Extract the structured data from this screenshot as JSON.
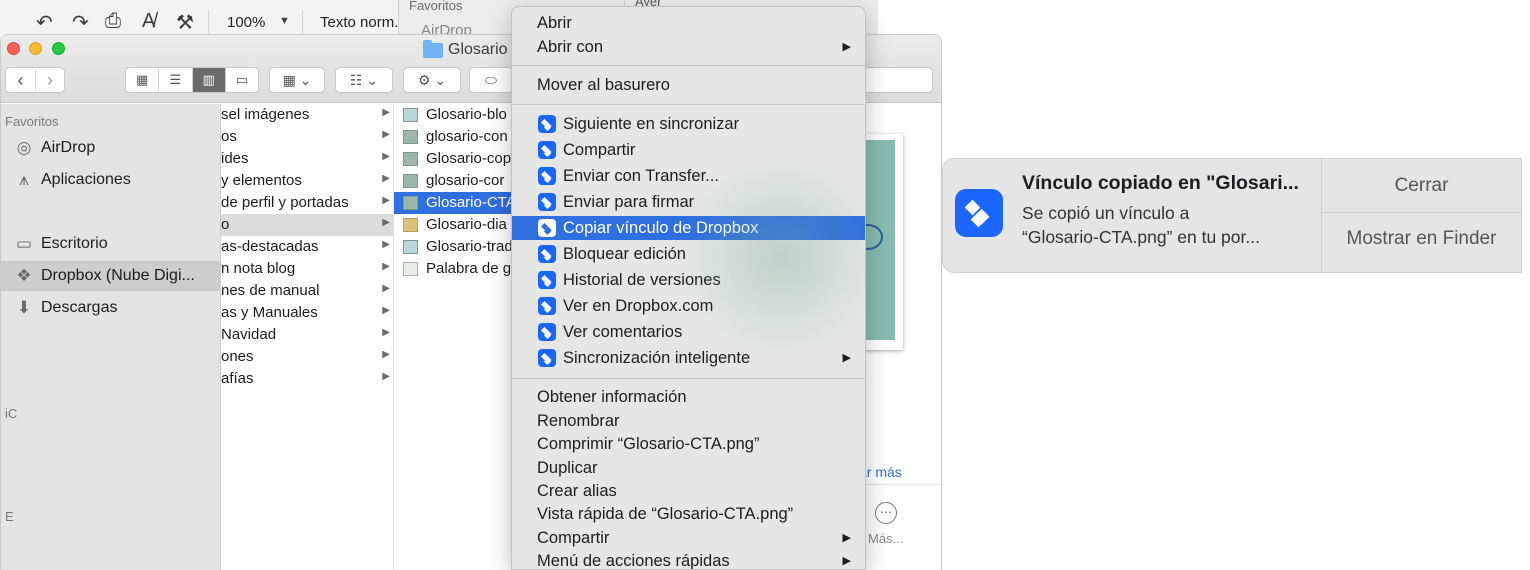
{
  "doc_toolbar": {
    "zoom": "100%",
    "style": "Texto norm..."
  },
  "bg_finder": {
    "favorites": "Favoritos",
    "airdrop": "AirDrop",
    "ayer": "Ayer"
  },
  "finder": {
    "title": "Glosario",
    "sidebar": {
      "header": "Favoritos",
      "items": [
        {
          "label": "AirDrop",
          "icon": "airdrop-icon"
        },
        {
          "label": "Aplicaciones",
          "icon": "applications-icon"
        },
        {
          "label": "Escritorio",
          "icon": "desktop-icon"
        },
        {
          "label": "Dropbox (Nube Digi...",
          "icon": "dropbox-icon",
          "selected": true
        },
        {
          "label": "Descargas",
          "icon": "downloads-icon"
        }
      ],
      "cut_labels": [
        "iC",
        "E"
      ]
    },
    "column1": [
      "sel imágenes",
      "os",
      "ides",
      "y elementos",
      "de perfil y portadas",
      "o",
      "as-destacadas",
      "n nota blog",
      "nes de manual",
      "as y Manuales",
      "Navidad",
      "ones",
      "afías"
    ],
    "column2": [
      "Glosario-blo",
      "glosario-con",
      "Glosario-cop",
      "glosario-cor",
      "Glosario-CTA",
      "Glosario-dia",
      "Glosario-trad",
      "Palabra de g"
    ],
    "preview": {
      "show_more": "ar más",
      "more_label": "Más..."
    }
  },
  "context_menu": {
    "items": [
      "Abrir",
      "Abrir con",
      "Mover al basurero",
      "Siguiente en sincronizar",
      "Compartir",
      "Enviar con Transfer...",
      "Enviar para firmar",
      "Copiar vínculo de Dropbox",
      "Bloquear edición",
      "Historial de versiones",
      "Ver en Dropbox.com",
      "Ver comentarios",
      "Sincronización inteligente",
      "Obtener información",
      "Renombrar",
      "Comprimir “Glosario-CTA.png”",
      "Duplicar",
      "Crear alias",
      "Vista rápida de “Glosario-CTA.png”",
      "Compartir",
      "Menú de acciones rápidas"
    ],
    "highlighted": "Copiar vínculo de Dropbox"
  },
  "notification": {
    "title": "Vínculo copiado en \"Glosari...",
    "body_line1": "Se copió un vínculo a",
    "body_line2": "“Glosario-CTA.png” en tu por...",
    "close_label": "Cerrar",
    "show_label": "Mostrar en Finder"
  },
  "colors": {
    "accent": "#2f6fe0",
    "dropbox": "#1a66ff"
  }
}
